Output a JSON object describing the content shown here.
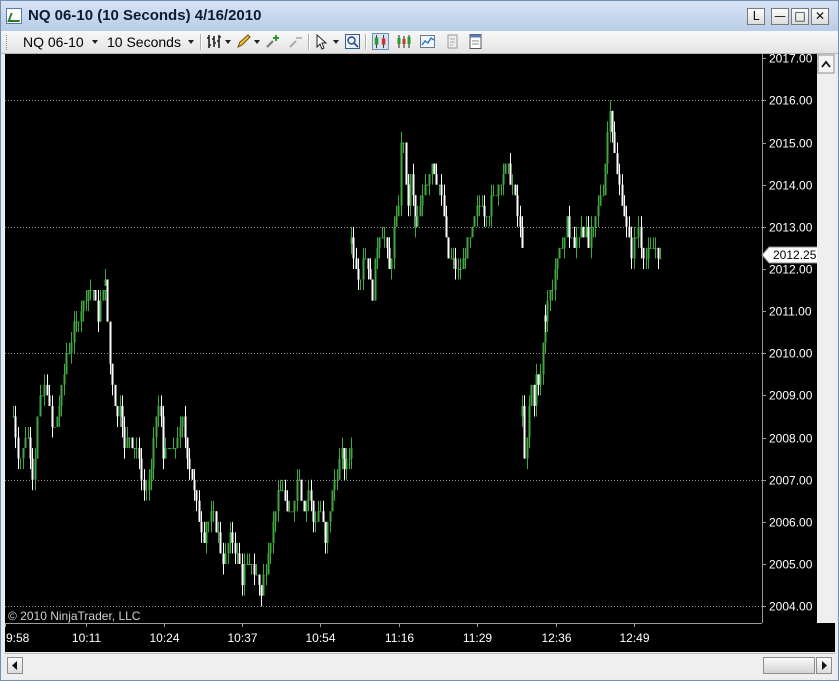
{
  "window": {
    "title": "NQ 06-10 (10 Seconds)  4/16/2010",
    "controls": [
      "L",
      "□",
      "✕"
    ],
    "minimize_symbol": "—"
  },
  "toolbar": {
    "instrument": "NQ 06-10",
    "interval": "10 Seconds",
    "icons": [
      "bar-type-icon",
      "drawing-pencil-icon",
      "add-indicator-icon",
      "remove-indicator-icon",
      "cursor-select-icon",
      "zoom-icon",
      "candlestick-style-icon",
      "ohlc-style-icon",
      "line-style-icon",
      "properties-icon",
      "data-box-icon"
    ]
  },
  "chart": {
    "copyright": "© 2010 NinjaTrader, LLC",
    "current_price_label": "2012.25",
    "y_tick_labels": [
      "2017.00",
      "2016.00",
      "2015.00",
      "2014.00",
      "2013.00",
      "2012.00",
      "2011.00",
      "2010.00",
      "2009.00",
      "2008.00",
      "2007.00",
      "2006.00",
      "2005.00",
      "2004.00"
    ],
    "x_tick_labels": [
      "9:58",
      "10:11",
      "10:24",
      "10:37",
      "10:54",
      "11:16",
      "11:29",
      "12:36",
      "12:49"
    ],
    "colors": {
      "background": "#000000",
      "up_bar": "#3ea83e",
      "down_bar": "#ffffff",
      "grid": "#8a8a8a",
      "axis_text": "#ffffff"
    }
  },
  "chart_data": {
    "type": "candlestick",
    "ylim": [
      2003.6,
      2017.1
    ],
    "y_ticks": [
      2017,
      2016,
      2015,
      2014,
      2013,
      2012,
      2011,
      2010,
      2009,
      2008,
      2007,
      2006,
      2005,
      2004
    ],
    "dotted_gridlines": [
      2016,
      2013,
      2010,
      2007,
      2004
    ],
    "x_ticks": [
      "9:58",
      "10:11",
      "10:24",
      "10:37",
      "10:54",
      "11:16",
      "11:29",
      "12:36",
      "12:49"
    ],
    "last_price": 2012.25,
    "segments": [
      {
        "from": "9:58",
        "to": "10:11",
        "closes": [
          2008.5,
          2007.4,
          2008.2,
          2007.1,
          2008.9,
          2009.3,
          2008.0,
          2008.8,
          2009.9,
          2010.4,
          2010.9,
          2011.4,
          2011.6,
          2010.9,
          2011.6
        ]
      },
      {
        "from": "10:11",
        "to": "10:24",
        "closes": [
          2011.6,
          2010.1,
          2009.2,
          2008.4,
          2008.9,
          2007.6,
          2008.1,
          2007.8,
          2007.9,
          2007.2,
          2006.7,
          2006.9,
          2007.3,
          2008.4,
          2008.7,
          2007.6
        ]
      },
      {
        "from": "10:24",
        "to": "10:37",
        "closes": [
          2007.6,
          2007.7,
          2008.4,
          2006.9,
          2005.7,
          2006.3,
          2005.1,
          2005.6,
          2004.7,
          2005.0,
          2004.3
        ]
      },
      {
        "from": "10:37",
        "to": "10:54",
        "closes": [
          2004.3,
          2005.1,
          2005.9,
          2006.4,
          2006.8,
          2005.9,
          2006.4,
          2007.2,
          2006.3,
          2006.8,
          2005.9,
          2006.5,
          2005.4,
          2006.4,
          2007.1,
          2007.6,
          2007.3,
          2007.9
        ]
      },
      {
        "from": "10:54",
        "to": "11:16",
        "closes": [
          2012.6,
          2012.2,
          2011.6,
          2012.4,
          2012.0,
          2011.3,
          2012.6,
          2012.9,
          2012.6,
          2011.9,
          2012.9,
          2013.3,
          2015.6,
          2013.4,
          2014.2,
          2013.0
        ]
      },
      {
        "from": "11:16",
        "to": "11:29",
        "closes": [
          2013.0,
          2013.9,
          2014.6,
          2013.9,
          2012.3,
          2011.9,
          2012.4,
          2012.9,
          2013.6,
          2013.3,
          2014.1,
          2014.5,
          2013.9,
          2012.6
        ]
      },
      {
        "from": "11:29",
        "to": "12:36",
        "closes": [
          2008.5,
          2007.2,
          2008.3,
          2009.4,
          2008.8,
          2009.6,
          2009.1,
          2010.1,
          2010.9
        ]
      },
      {
        "from": "12:36",
        "to": "12:49",
        "closes": [
          2010.9,
          2011.7,
          2012.4,
          2013.1,
          2012.5,
          2013.2,
          2012.6,
          2013.1,
          2014.0,
          2015.8,
          2014.3,
          2013.3,
          2012.4,
          2013.0,
          2012.2,
          2012.6,
          2012.25
        ]
      }
    ]
  }
}
